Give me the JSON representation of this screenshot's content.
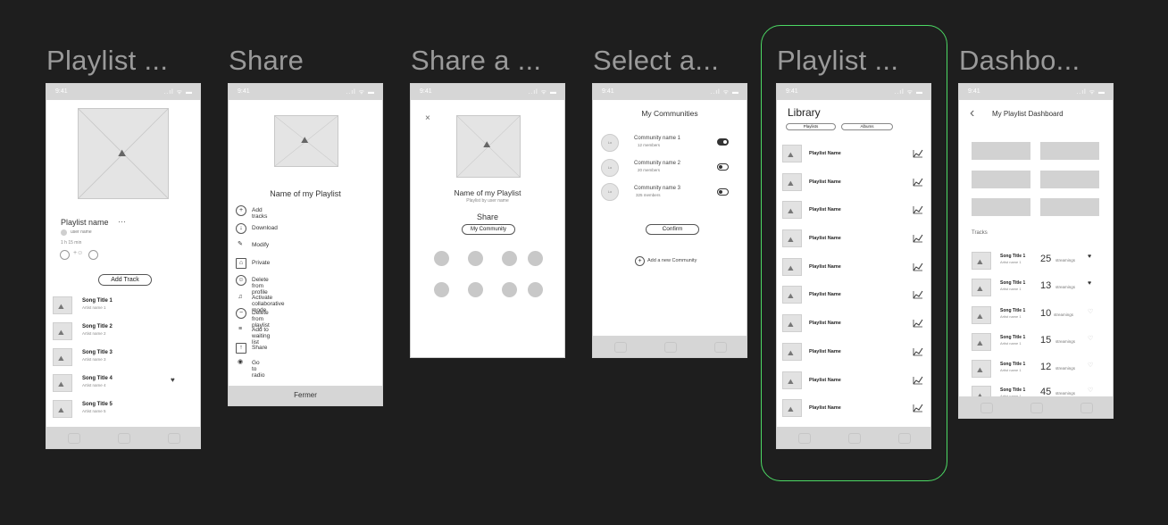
{
  "colors": {
    "canvas": "#1e1e1e",
    "selection": "#4cd964",
    "frame_title": "#9a9a9a"
  },
  "frames": {
    "f1": {
      "title": "Playlist ..."
    },
    "f2": {
      "title": "Share"
    },
    "f3": {
      "title": "Share a ..."
    },
    "f4": {
      "title": "Select a..."
    },
    "f5": {
      "title": "Playlist ..."
    },
    "f6": {
      "title": "Dashbo..."
    }
  },
  "status": {
    "time": "9:41",
    "icons": "..ıl ᯤ ▬"
  },
  "playlist": {
    "name": "Playlist name",
    "more": "···",
    "user": "user name",
    "duration": "1 h 15 min",
    "add_track": "Add Track",
    "songs": [
      {
        "title": "Song Title 1",
        "artist": "Artist name 1"
      },
      {
        "title": "Song Title 2",
        "artist": "Artist name 2"
      },
      {
        "title": "Song Title 3",
        "artist": "Artist name 3"
      },
      {
        "title": "Song Title 4",
        "artist": "Artist name 4"
      },
      {
        "title": "Song Title 5",
        "artist": "Artist name 5"
      }
    ]
  },
  "share": {
    "title": "Name of my Playlist",
    "menu": [
      {
        "icon": "+",
        "label": "Add tracks"
      },
      {
        "icon": "↓",
        "label": "Download"
      },
      {
        "icon": "✎",
        "label": "Modify"
      },
      {
        "icon": "⌂",
        "label": "Private"
      },
      {
        "icon": "☺",
        "label": "Delete from profile"
      },
      {
        "icon": "♫",
        "label": "Activate collaborative mode"
      },
      {
        "icon": "−",
        "label": "Delete from playlist"
      },
      {
        "icon": "≡",
        "label": "Add to waiting list"
      },
      {
        "icon": "↑",
        "label": "Share"
      },
      {
        "icon": "◉",
        "label": "Go to radio"
      }
    ],
    "close": "Fermer"
  },
  "share_a": {
    "close": "×",
    "title": "Name of my Playlist",
    "subtitle": "Playlist by user name",
    "share": "Share",
    "community_btn": "My Community"
  },
  "select": {
    "title": "My Communities",
    "communities": [
      {
        "name": "Community name 1",
        "members": "12 members",
        "avatar": "Lo",
        "on": true
      },
      {
        "name": "Community name 2",
        "members": "20 members",
        "avatar": "Lo",
        "on": false
      },
      {
        "name": "Community name 3",
        "members": "325 members",
        "avatar": "Lo",
        "on": false
      }
    ],
    "confirm": "Confirm",
    "add": "Add a new Community"
  },
  "library": {
    "title": "Library",
    "tabs": [
      "Playlists",
      "Albums"
    ],
    "items": [
      "Playlist Name",
      "Playlist Name",
      "Playlist Name",
      "Playlist Name",
      "Playlist Name",
      "Playlist Name",
      "Playlist Name",
      "Playlist Name",
      "Playlist Name",
      "Playlist Name"
    ]
  },
  "dashboard": {
    "back": "‹",
    "title": "My Playlist Dashboard",
    "tracks_label": "Tracks",
    "tracks": [
      {
        "title": "Song Title 1",
        "artist": "Artist name 1",
        "count": "25",
        "unit": "streamings",
        "liked": true
      },
      {
        "title": "Song Title 1",
        "artist": "Artist name 1",
        "count": "13",
        "unit": "streamings",
        "liked": true
      },
      {
        "title": "Song Title 1",
        "artist": "Artist name 1",
        "count": "10",
        "unit": "streamings",
        "liked": false
      },
      {
        "title": "Song Title 1",
        "artist": "Artist name 1",
        "count": "15",
        "unit": "streamings",
        "liked": false
      },
      {
        "title": "Song Title 1",
        "artist": "Artist name 1",
        "count": "12",
        "unit": "streamings",
        "liked": false
      },
      {
        "title": "Song Title 1",
        "artist": "Artist name 1",
        "count": "45",
        "unit": "streamings",
        "liked": false
      }
    ]
  }
}
